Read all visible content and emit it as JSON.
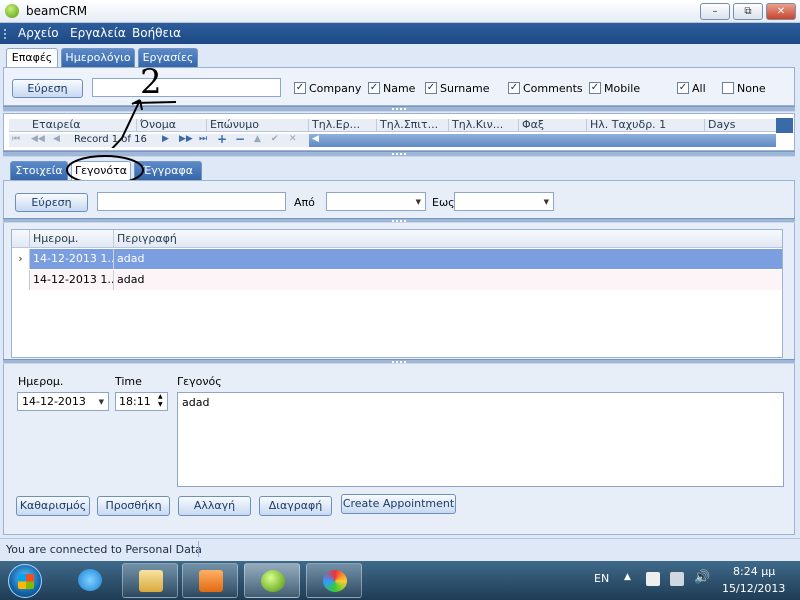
{
  "window": {
    "title": "beamCRM",
    "minimize": "–",
    "maximize": "⧉",
    "close": "✕"
  },
  "menu": {
    "items": [
      "Αρχείο",
      "Εργαλεία",
      "Βοήθεια"
    ]
  },
  "main_tabs": [
    "Επαφές",
    "Ημερολόγιο",
    "Εργασίες"
  ],
  "search": {
    "button": "Εύρεση",
    "value": ""
  },
  "filters": [
    {
      "label": "Company",
      "checked": true
    },
    {
      "label": "Name",
      "checked": true
    },
    {
      "label": "Surname",
      "checked": true
    },
    {
      "label": "Comments",
      "checked": true
    },
    {
      "label": "Mobile",
      "checked": true
    },
    {
      "label": "All",
      "checked": true
    },
    {
      "label": "None",
      "checked": false
    }
  ],
  "contacts_grid": {
    "columns": [
      "Εταιρεία",
      "Όνομα",
      "Επώνυμο",
      "Τηλ.Ερ...",
      "Τηλ.Σπιτ...",
      "Τηλ.Κιν...",
      "Φαξ",
      "Ηλ. Ταχυδρ. 1",
      "Days"
    ],
    "navigator": {
      "record_text": "Record 1 of 16"
    }
  },
  "annotation": {
    "number": "2"
  },
  "sub_tabs": [
    "Στοιχεία",
    "Γεγονότα",
    "Έγγραφα"
  ],
  "events_filter": {
    "button": "Εύρεση",
    "from_label": "Από",
    "to_label": "Εως"
  },
  "events_grid": {
    "columns": [
      "Ημερομ.",
      "Περιγραφή"
    ],
    "rows": [
      {
        "date": "14-12-2013 1...",
        "desc": "adad"
      },
      {
        "date": "14-12-2013 1...",
        "desc": "adad"
      }
    ]
  },
  "detail": {
    "date_label": "Ημερομ.",
    "date_value": "14-12-2013",
    "time_label": "Time",
    "time_value": "18:11",
    "event_label": "Γεγονός",
    "event_text": "adad"
  },
  "actions": [
    "Καθαρισμός",
    "Προσθήκη",
    "Αλλαγή",
    "Διαγραφή",
    "Create Appointment"
  ],
  "status": {
    "text": "You are connected to Personal Data"
  },
  "tray": {
    "lang": "EN",
    "time": "8:24 μμ",
    "date": "15/12/2013"
  },
  "colors": {
    "menubar": "#2d5c9a",
    "tab": "#3566a8",
    "selected_row": "#7a9ee0"
  }
}
